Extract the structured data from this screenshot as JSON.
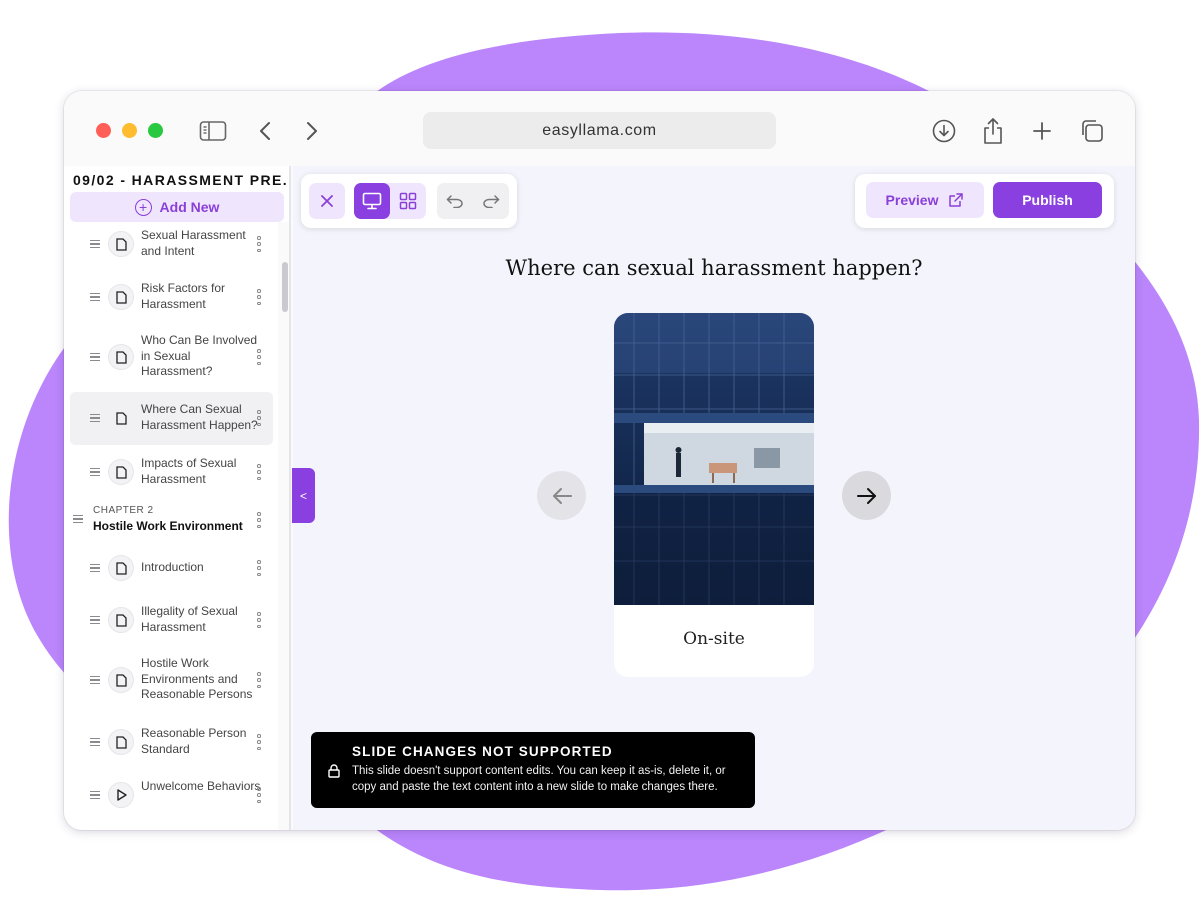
{
  "browser": {
    "url": "easyllama.com"
  },
  "sidebar": {
    "course_title": "09/02 - HARASSMENT PRE...",
    "add_new": "Add New",
    "lessons_before": [
      {
        "title": "Sexual Harassment and Intent",
        "type": "document"
      },
      {
        "title": "Risk Factors for Harassment",
        "type": "document"
      },
      {
        "title": "Who Can Be Involved in Sexual Harassment?",
        "type": "document"
      },
      {
        "title": "Where Can Sexual Harassment Happen?",
        "type": "document"
      },
      {
        "title": "Impacts of Sexual Harassment",
        "type": "document"
      }
    ],
    "chapter": {
      "label": "CHAPTER 2",
      "title": "Hostile Work Environment"
    },
    "lessons_after": [
      {
        "title": "Introduction",
        "type": "document"
      },
      {
        "title": "Illegality of Sexual Harassment",
        "type": "document"
      },
      {
        "title": "Hostile Work Environments and Reasonable Persons",
        "type": "document"
      },
      {
        "title": "Reasonable Person Standard",
        "type": "document"
      },
      {
        "title": "Unwelcome Behaviors",
        "type": "video"
      }
    ]
  },
  "toolbar": {
    "preview_label": "Preview",
    "publish_label": "Publish"
  },
  "slide": {
    "question": "Where can sexual harassment happen?",
    "card_label": "On-site"
  },
  "toast": {
    "title": "SLIDE CHANGES NOT SUPPORTED",
    "body": "This slide doesn't support content edits. You can keep it as-is, delete it, or copy and paste the text content into a new slide to make changes there."
  },
  "colors": {
    "accent": "#8a3fe0",
    "accent_light": "#efe6fd",
    "blob": "#bb86fc"
  }
}
